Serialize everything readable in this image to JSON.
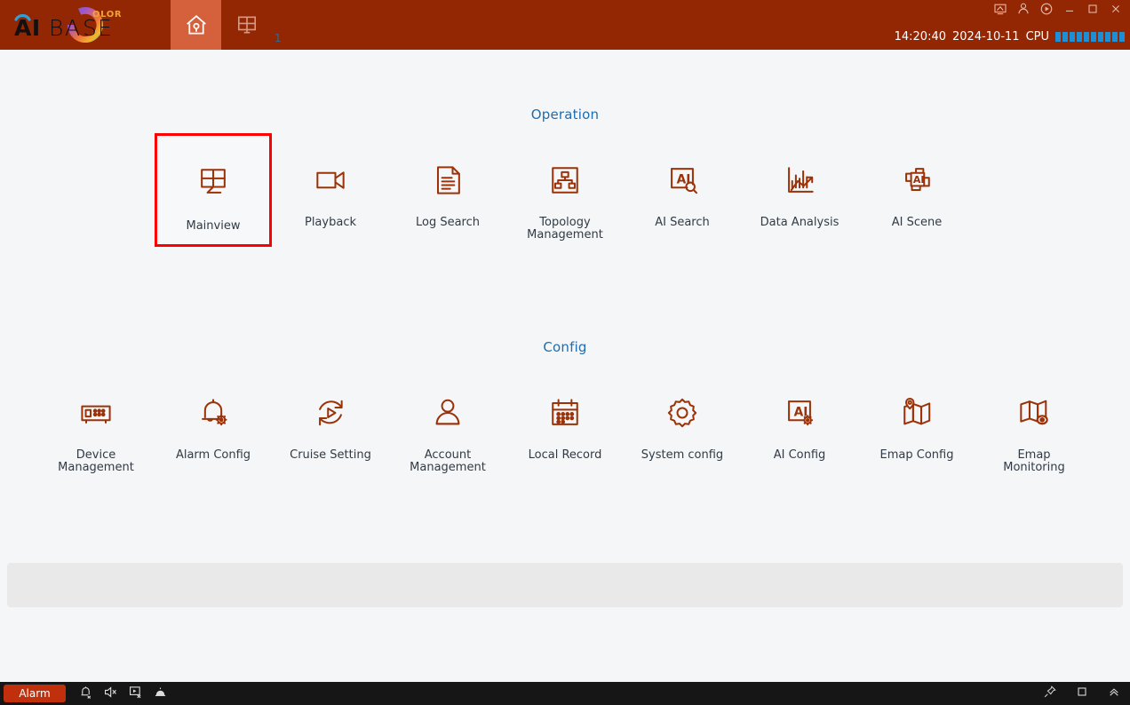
{
  "titlebar": {
    "logo": {
      "brand_main": "AIBASE",
      "brand_sub": "OLOR",
      "icon": "aibase-logo"
    },
    "tabs": [
      {
        "icon": "home-icon",
        "name": "tab-home",
        "active": true,
        "badge": ""
      },
      {
        "icon": "mainview-grid-icon",
        "name": "tab-mainview",
        "active": false,
        "badge": "1"
      }
    ],
    "window_icons": [
      {
        "name": "screen-icon",
        "label": "screen"
      },
      {
        "name": "user-icon",
        "label": "user"
      },
      {
        "name": "record-icon",
        "label": "record"
      },
      {
        "name": "minimize-icon",
        "label": "minimize"
      },
      {
        "name": "maximize-icon",
        "label": "maximize"
      },
      {
        "name": "close-icon",
        "label": "close"
      }
    ],
    "status": {
      "time": "14:20:40",
      "date": "2024-10-11",
      "cpu_label": "CPU",
      "cpu_blocks": 10,
      "cpu_color": "#1e8fd5"
    }
  },
  "main": {
    "operation": {
      "title": "Operation",
      "items": [
        {
          "label": "Mainview",
          "icon": "mainview-monitor-icon",
          "selected": true
        },
        {
          "label": "Playback",
          "icon": "video-camera-icon",
          "selected": false
        },
        {
          "label": "Log Search",
          "icon": "document-lines-icon",
          "selected": false
        },
        {
          "label": "Topology\nManagement",
          "icon": "topology-tree-icon",
          "selected": false
        },
        {
          "label": "AI Search",
          "icon": "ai-search-icon",
          "selected": false
        },
        {
          "label": "Data Analysis",
          "icon": "bar-chart-arrow-icon",
          "selected": false
        },
        {
          "label": "AI Scene",
          "icon": "ai-scene-icon",
          "selected": false
        }
      ]
    },
    "config": {
      "title": "Config",
      "items": [
        {
          "label": "Device\nManagement",
          "icon": "nvr-device-icon"
        },
        {
          "label": "Alarm Config",
          "icon": "bell-gear-icon"
        },
        {
          "label": "Cruise Setting",
          "icon": "cruise-refresh-play-icon"
        },
        {
          "label": "Account\nManagement",
          "icon": "person-icon"
        },
        {
          "label": "Local Record",
          "icon": "calendar-icon"
        },
        {
          "label": "System config",
          "icon": "gear-icon"
        },
        {
          "label": "AI Config",
          "icon": "ai-gear-icon"
        },
        {
          "label": "Emap Config",
          "icon": "map-pin-icon"
        },
        {
          "label": "Emap\nMonitoring",
          "icon": "map-eye-icon"
        }
      ]
    }
  },
  "taskbar": {
    "alarm_label": "Alarm",
    "left_icons": [
      {
        "name": "bell-muted-icon"
      },
      {
        "name": "speaker-muted-icon"
      },
      {
        "name": "screen-off-icon"
      },
      {
        "name": "alarm-dome-icon"
      }
    ],
    "right_icons": [
      {
        "name": "pin-icon"
      },
      {
        "name": "square-icon"
      },
      {
        "name": "chevron-double-up-icon"
      }
    ]
  },
  "colors": {
    "titlebar": "#932603",
    "tab_active": "#d4603c",
    "body_bg": "#f4f6f8",
    "icon": "#9b3208",
    "accent_blue": "#1f6cb0",
    "selection_red": "#ff0000",
    "alarm_red": "#c1300c",
    "taskbar": "#161616"
  }
}
